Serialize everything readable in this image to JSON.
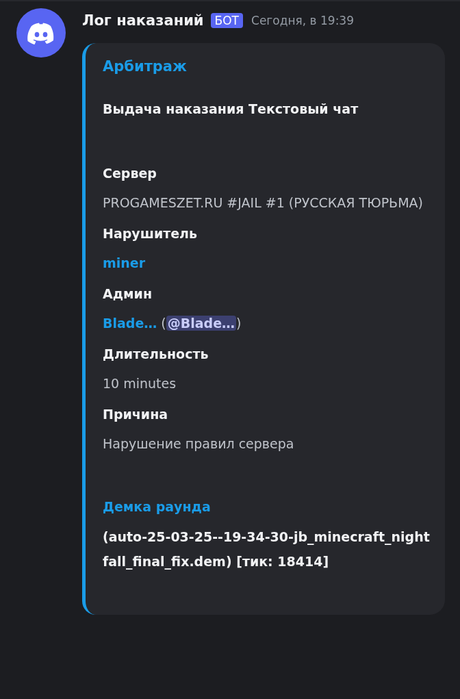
{
  "message": {
    "author": "Лог наказаний",
    "badge": "БОТ",
    "timestamp": "Сегодня, в 19:39"
  },
  "embed": {
    "title": "Арбитраж",
    "description": "Выдача наказания Текстовый чат",
    "fields": [
      {
        "name": "Сервер",
        "value": [
          {
            "kind": "text",
            "text": "PROGAMESZET.RU #JAIL #1 (РУССКАЯ ТЮРЬМА)"
          }
        ]
      },
      {
        "name": "Нарушитель",
        "value": [
          {
            "kind": "link",
            "text": "miner"
          }
        ]
      },
      {
        "name": "Админ",
        "value": [
          {
            "kind": "link",
            "text": "Blade…"
          },
          {
            "kind": "text",
            "text": " ("
          },
          {
            "kind": "mention",
            "text": "@Blade…"
          },
          {
            "kind": "text",
            "text": ")"
          }
        ]
      },
      {
        "name": "Длительность",
        "value": [
          {
            "kind": "text",
            "text": "10 minutes"
          }
        ]
      },
      {
        "name": "Причина",
        "value": [
          {
            "kind": "text",
            "text": "Нарушение правил сервера"
          }
        ]
      }
    ],
    "footer_title": "Демка раунда",
    "footer_text": "(auto-25-03-25--19-34-30-jb_minecraft_nightfall_final_fix.dem) [тик: 18414]"
  }
}
